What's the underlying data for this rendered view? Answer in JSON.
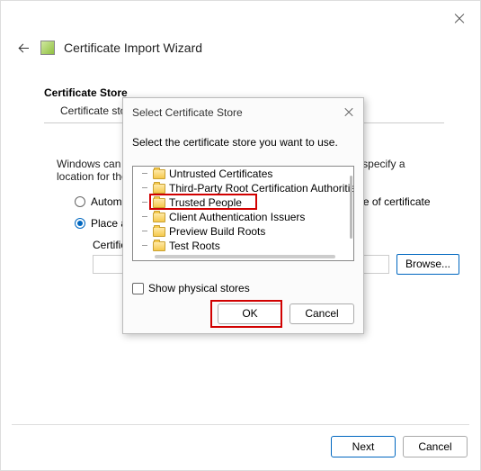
{
  "window": {
    "title": "Certificate Import Wizard"
  },
  "section": {
    "title": "Certificate Store",
    "description": "Certificate stores are system areas where certificates are kept."
  },
  "body": {
    "intro": "Windows can automatically select a certificate store, or you can specify a location for the certificate."
  },
  "radios": {
    "auto": "Automatically select the certificate store based on the type of certificate",
    "place": "Place all certificates in the following store"
  },
  "store_field": {
    "label": "Certificate store:",
    "browse": "Browse..."
  },
  "buttons": {
    "next": "Next",
    "cancel": "Cancel"
  },
  "modal": {
    "title": "Select Certificate Store",
    "prompt": "Select the certificate store you want to use.",
    "items": [
      "Untrusted Certificates",
      "Third-Party Root Certification Authorities",
      "Trusted People",
      "Client Authentication Issuers",
      "Preview Build Roots",
      "Test Roots"
    ],
    "show_physical": "Show physical stores",
    "ok": "OK",
    "cancel": "Cancel"
  }
}
